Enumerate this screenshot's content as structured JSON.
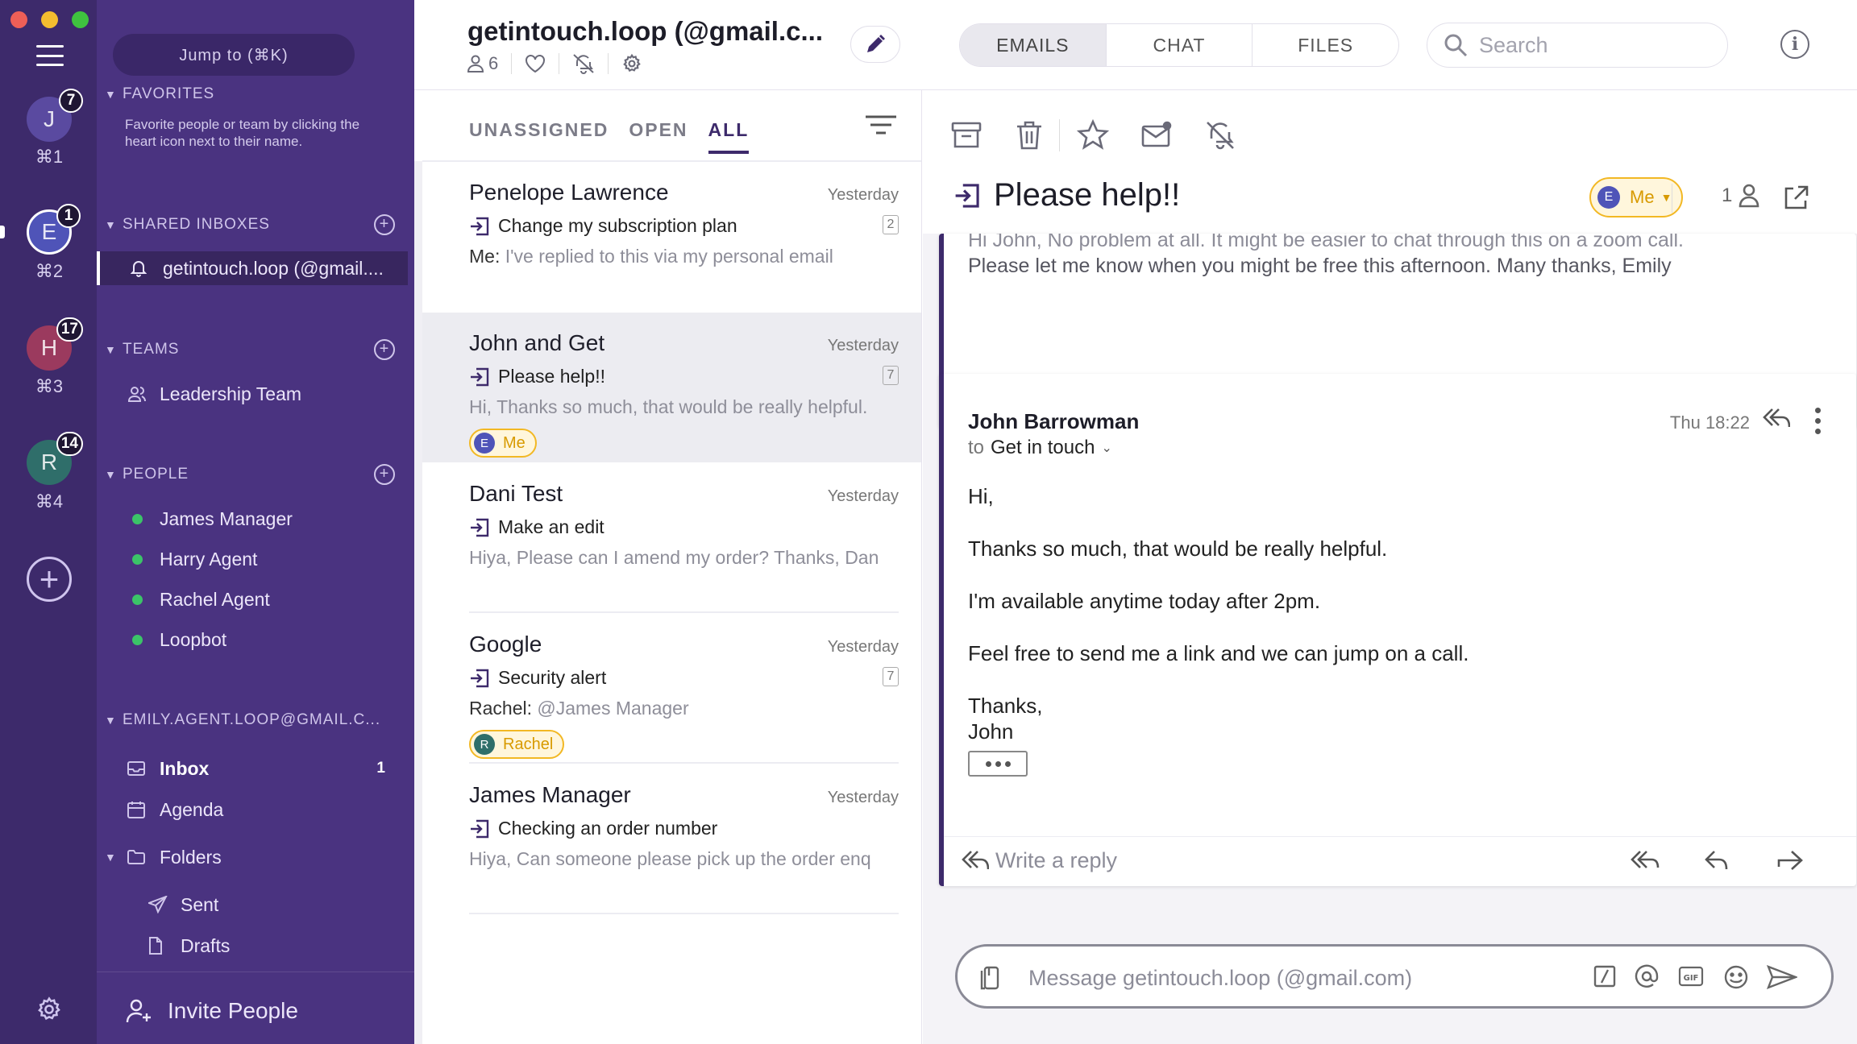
{
  "rail": {
    "workspaces": [
      {
        "letter": "J",
        "badge": "7",
        "shortcut": "⌘1",
        "color": "#5a4aa0"
      },
      {
        "letter": "E",
        "badge": "1",
        "shortcut": "⌘2",
        "color": "#4f54b8"
      },
      {
        "letter": "H",
        "badge": "17",
        "shortcut": "⌘3",
        "color": "#9b3a5e"
      },
      {
        "letter": "R",
        "badge": "14",
        "shortcut": "⌘4",
        "color": "#2f6e6a"
      }
    ]
  },
  "sidebar": {
    "jump_label": "Jump to (⌘K)",
    "favorites_label": "FAVORITES",
    "favorites_hint": "Favorite people or team by clicking the heart icon next to their name.",
    "shared_inboxes_label": "SHARED INBOXES",
    "shared_inbox_item": "getintouch.loop (@gmail....",
    "teams_label": "TEAMS",
    "team_item": "Leadership Team",
    "people_label": "PEOPLE",
    "people": [
      "James Manager",
      "Harry Agent",
      "Rachel Agent",
      "Loopbot"
    ],
    "personal_label": "EMILY.AGENT.LOOP@GMAIL.C...",
    "inbox_label": "Inbox",
    "inbox_count": "1",
    "agenda_label": "Agenda",
    "folders_label": "Folders",
    "sent_label": "Sent",
    "drafts_label": "Drafts",
    "invite_label": "Invite People"
  },
  "header": {
    "title": "getintouch.loop (@gmail.c...",
    "members_count": "6",
    "tabs": [
      "EMAILS",
      "CHAT",
      "FILES"
    ],
    "search_placeholder": "Search"
  },
  "list": {
    "tabs": [
      "UNASSIGNED",
      "OPEN",
      "ALL"
    ],
    "conversations": [
      {
        "who": "Penelope Lawrence",
        "when": "Yesterday",
        "subject": "Change my subscription plan",
        "count": "2",
        "prefix": "Me:",
        "preview": "I've replied to this via my personal email"
      },
      {
        "who": "John and Get",
        "when": "Yesterday",
        "subject": "Please help!!",
        "count": "7",
        "prefix": "",
        "preview": "Hi, Thanks so much, that would be really helpful.",
        "chip_letter": "E",
        "chip_label": "Me"
      },
      {
        "who": "Dani Test",
        "when": "Yesterday",
        "subject": "Make an edit",
        "count": "",
        "prefix": "",
        "preview": "Hiya, Please can I amend my order? Thanks, Dan"
      },
      {
        "who": "Google",
        "when": "Yesterday",
        "subject": "Security alert",
        "count": "7",
        "prefix": "Rachel:",
        "preview": "@James Manager",
        "chip_letter": "R",
        "chip_label": "Rachel"
      },
      {
        "who": "James Manager",
        "when": "Yesterday",
        "subject": "Checking an order number",
        "count": "",
        "prefix": "",
        "preview": "Hiya, Can someone please pick up the order enq"
      }
    ]
  },
  "thread": {
    "title": "Please help!!",
    "assignee_letter": "E",
    "assignee_label": "Me",
    "participants": "1",
    "prev_message_cut": "Hi John, No problem at all. It might be easier to chat through this on a zoom call.",
    "prev_message_line": "Please let me know when you might be free this afternoon. Many thanks, Emily",
    "message": {
      "sender": "John Barrowman",
      "to_prefix": "to",
      "to": "Get in touch",
      "time": "Thu 18:22",
      "greeting": "Hi,",
      "p1": "Thanks so much, that would be really helpful.",
      "p2": "I'm available anytime today after 2pm.",
      "p3": "Feel free to send me a link and we can jump on a call.",
      "signoff": "Thanks,",
      "signature": "John"
    },
    "reply_placeholder": "Write a reply",
    "composer_placeholder": "Message getintouch.loop (@gmail.com)"
  }
}
